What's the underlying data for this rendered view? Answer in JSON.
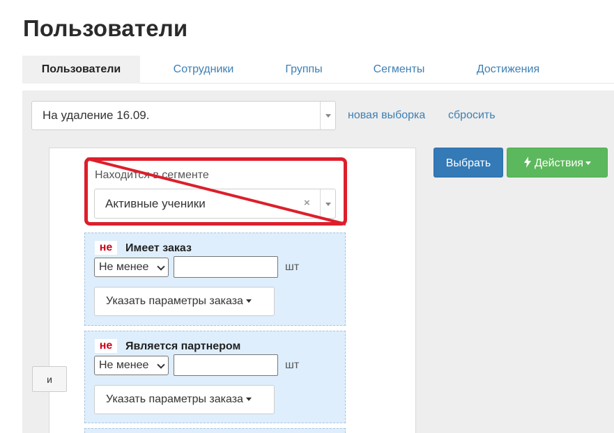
{
  "page": {
    "title": "Пользователи"
  },
  "tabs": [
    {
      "label": "Пользователи",
      "active": true
    },
    {
      "label": "Сотрудники",
      "active": false
    },
    {
      "label": "Группы",
      "active": false
    },
    {
      "label": "Сегменты",
      "active": false
    },
    {
      "label": "Достижения",
      "active": false
    }
  ],
  "selection": {
    "current": "На удаление 16.09.",
    "new_link": "новая выборка",
    "reset_link": "сбросить"
  },
  "actions": {
    "choose_label": "Выбрать",
    "actions_label": "Действия"
  },
  "logic": {
    "and_label": "и"
  },
  "segment_condition": {
    "label": "Находится в сегменте",
    "value": "Активные ученики",
    "clear_symbol": "×"
  },
  "conditions": [
    {
      "negation": "не",
      "title": "Имеет заказ",
      "operator": "Не менее",
      "value": "",
      "unit": "шт",
      "params_label": "Указать параметры заказа"
    },
    {
      "negation": "не",
      "title": "Является партнером",
      "operator": "Не менее",
      "value": "",
      "unit": "шт",
      "params_label": "Указать параметры заказа"
    }
  ],
  "colors": {
    "link": "#3d7fb3",
    "primary": "#337ab7",
    "success": "#5cb85c",
    "annotation": "#dc1f2b",
    "condition_bg": "#deeefc"
  }
}
